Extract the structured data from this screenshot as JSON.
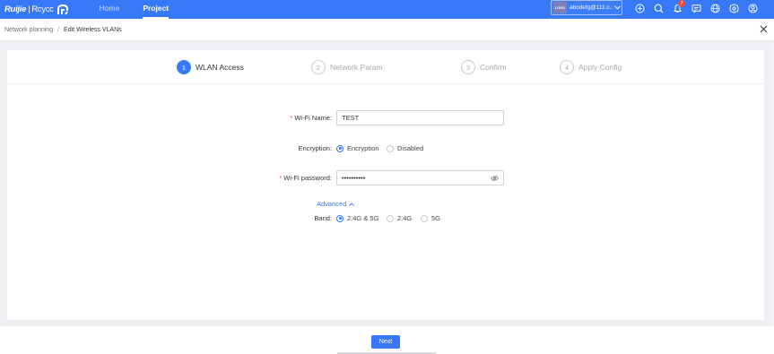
{
  "brand": {
    "name": "Ruijie",
    "separator": "|",
    "product": "Rcycc"
  },
  "nav": {
    "home": "Home",
    "project": "Project"
  },
  "account": {
    "logo_text": "LOGO",
    "email": "abcdefg@111.c..."
  },
  "notifications": {
    "count": "7"
  },
  "toolbar_icons": [
    "plus-circle-icon",
    "search-icon",
    "bell-icon",
    "message-icon",
    "globe-icon",
    "settings-icon",
    "user-icon"
  ],
  "breadcrumb": {
    "parent": "Network planning",
    "separator": "/",
    "current": "Edit Wireless VLANs"
  },
  "steps": [
    {
      "num": "1",
      "label": "WLAN Access",
      "active": true
    },
    {
      "num": "2",
      "label": "Network Param",
      "active": false
    },
    {
      "num": "3",
      "label": "Confirm",
      "active": false
    },
    {
      "num": "4",
      "label": "Apply Config",
      "active": false
    }
  ],
  "form": {
    "wifi_name": {
      "required_mark": "*",
      "label": "Wi-Fi Name:",
      "value": "TEST"
    },
    "encryption": {
      "label": "Encryption:",
      "options": [
        "Encryption",
        "Disabled"
      ],
      "selected": "Encryption"
    },
    "wifi_password": {
      "required_mark": "*",
      "label": "Wi-Fi password:",
      "value": "••••••••••"
    },
    "advanced_label": "Advanced",
    "band": {
      "label": "Band:",
      "options": [
        "2.4G & 5G",
        "2.4G",
        "5G"
      ],
      "selected": "2.4G & 5G"
    }
  },
  "footer": {
    "next_label": "Next"
  },
  "colors": {
    "primary": "#3778f6",
    "required": "#f04848",
    "page_bg": "#eef0f3"
  }
}
